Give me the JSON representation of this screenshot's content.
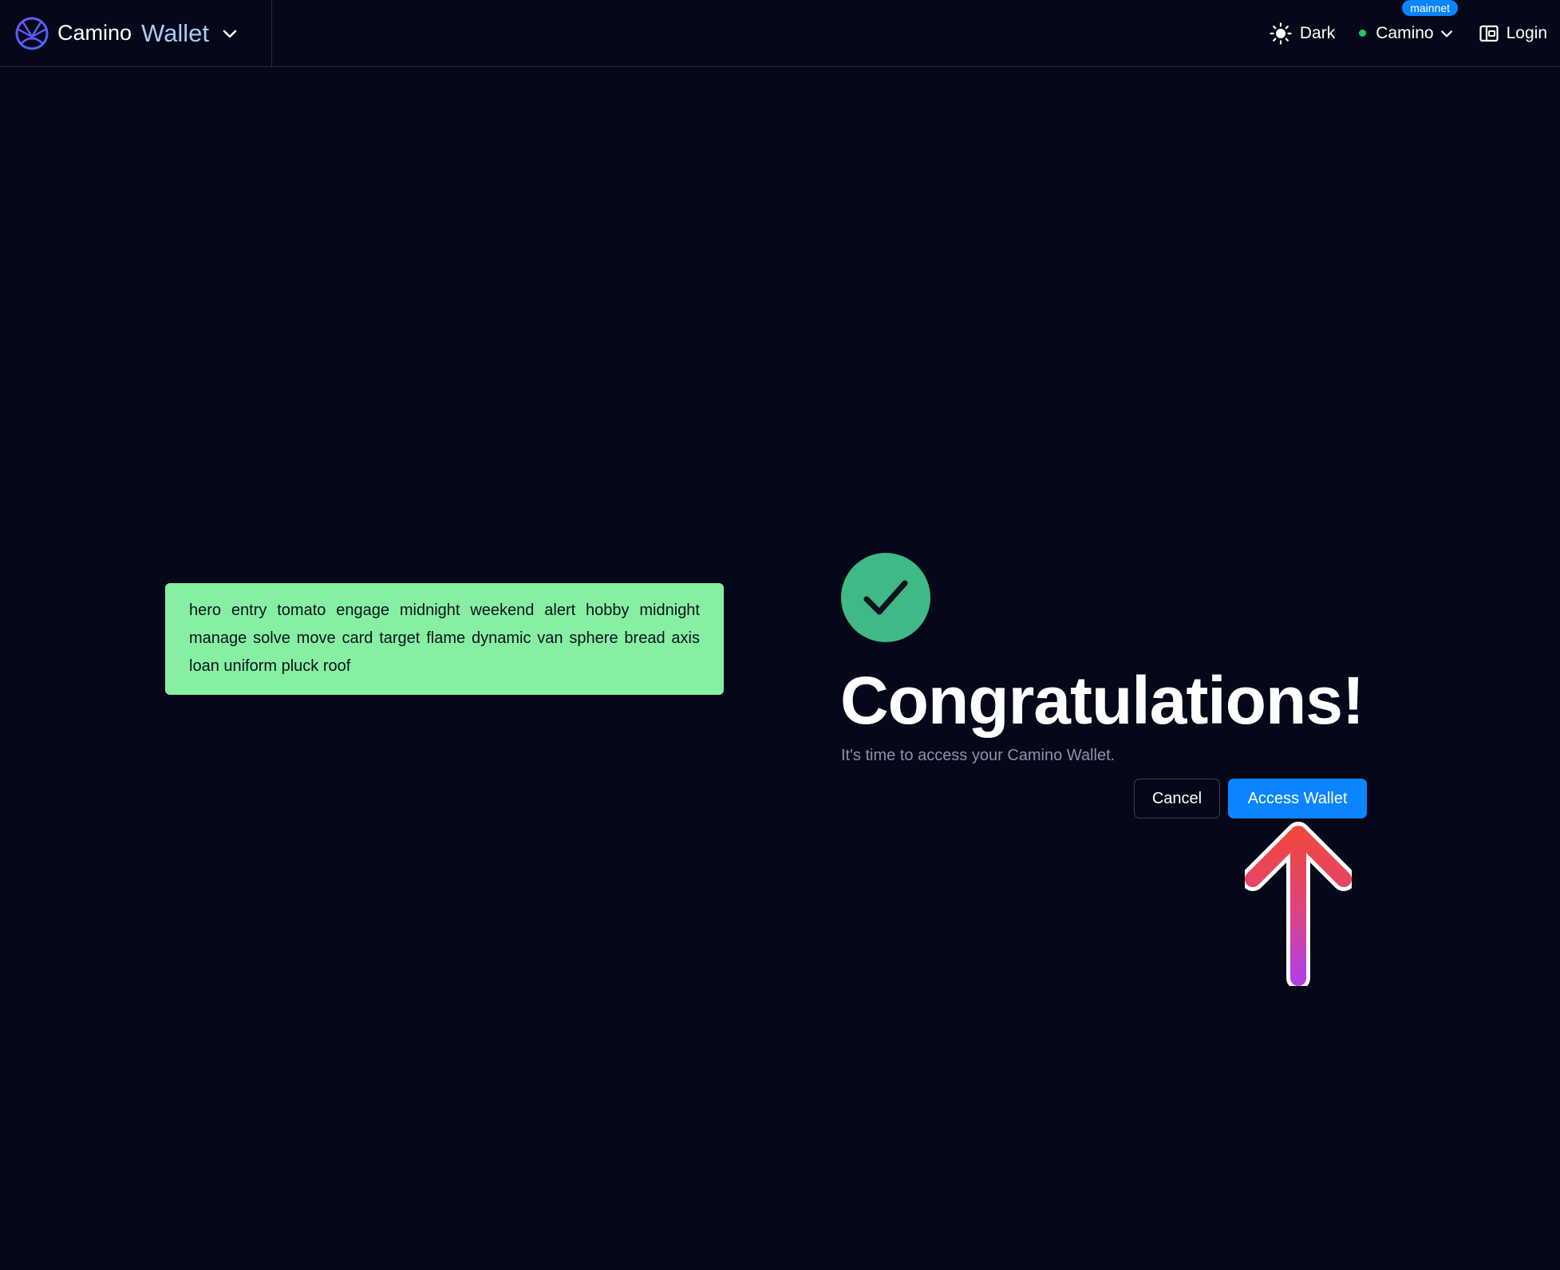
{
  "header": {
    "brand_primary": "Camino",
    "brand_secondary": "Wallet",
    "theme_label": "Dark",
    "network_label": "Camino",
    "network_badge": "mainnet",
    "login_label": "Login"
  },
  "mnemonic": {
    "phrase": "hero entry tomato engage midnight weekend alert hobby midnight manage solve move card target flame dynamic van sphere bread axis loan uniform pluck roof"
  },
  "success": {
    "title": "Congratulations!",
    "subtitle": "It's time to access your Camino Wallet.",
    "cancel_label": "Cancel",
    "access_label": "Access Wallet"
  },
  "colors": {
    "background": "#050818",
    "accent": "#0a84ff",
    "success": "#3fb985",
    "mnemonic_bg": "#86efa2",
    "network_status": "#22c55e"
  },
  "icons": {
    "logo": "camino-logo-icon",
    "theme": "sun-icon",
    "login": "wallet-icon",
    "success": "checkmark-icon",
    "pointer": "arrow-up-icon"
  }
}
